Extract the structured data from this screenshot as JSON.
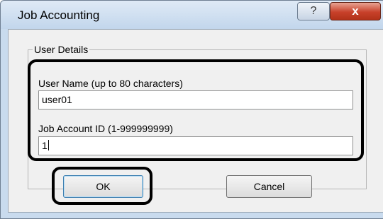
{
  "window": {
    "title": "Job Accounting",
    "help_label": "?",
    "close_label": "x"
  },
  "group": {
    "title": "User Details"
  },
  "fields": {
    "user_name_label": "User Name (up to 80 characters)",
    "user_name_value": "user01",
    "job_id_label": "Job Account ID (1-999999999)",
    "job_id_value": "1"
  },
  "buttons": {
    "ok_label": "OK",
    "cancel_label": "Cancel"
  },
  "colors": {
    "titlebar": "#c9dbee",
    "dialog_body": "#f0f0f0",
    "close_button": "#c8412a",
    "callout_border": "#000000"
  }
}
